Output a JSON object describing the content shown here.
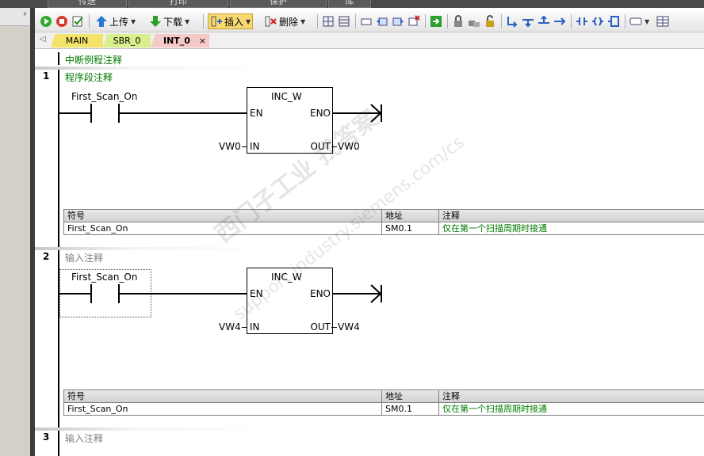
{
  "top_tabs": [
    "传送",
    "打印",
    "保护",
    "库"
  ],
  "toolbar": {
    "upload_label": "上传",
    "download_label": "下载",
    "insert_label": "插入",
    "delete_label": "删除"
  },
  "tabs": [
    {
      "label": "MAIN"
    },
    {
      "label": "SBR_0"
    },
    {
      "label": "INT_0"
    }
  ],
  "tab_close": "×",
  "tab_scroll": "◁",
  "pin_glyph": "ᵖ",
  "routine_comment": "中断例程注释",
  "networks": [
    {
      "number": "1",
      "comment": "程序段注释",
      "contact_label": "First_Scan_On",
      "box_title": "INC_W",
      "en": "EN",
      "eno": "ENO",
      "in_pin": "IN",
      "out_pin": "OUT",
      "in_operand": "VW0",
      "out_operand": "VW0",
      "symbol_table": {
        "headers": [
          "符号",
          "地址",
          "注释"
        ],
        "rows": [
          [
            "First_Scan_On",
            "SM0.1",
            "仅在第一个扫描周期时接通"
          ]
        ]
      }
    },
    {
      "number": "2",
      "comment": "输入注释",
      "contact_label": "First_Scan_On",
      "box_title": "INC_W",
      "en": "EN",
      "eno": "ENO",
      "in_pin": "IN",
      "out_pin": "OUT",
      "in_operand": "VW4",
      "out_operand": "VW4",
      "symbol_table": {
        "headers": [
          "符号",
          "地址",
          "注释"
        ],
        "rows": [
          [
            "First_Scan_On",
            "SM0.1",
            "仅在第一个扫描周期时接通"
          ]
        ]
      }
    },
    {
      "number": "3",
      "comment": "输入注释"
    }
  ],
  "watermark": {
    "line1": "西门子工业  找答案",
    "line2": "support.industry.siemens.com/cs"
  },
  "colors": {
    "comment_green": "#007a00",
    "placeholder_grey": "#808080",
    "tab_main": "#f5e46a",
    "tab_sbr": "#d9ef8e",
    "tab_int": "#f6c9c9"
  }
}
